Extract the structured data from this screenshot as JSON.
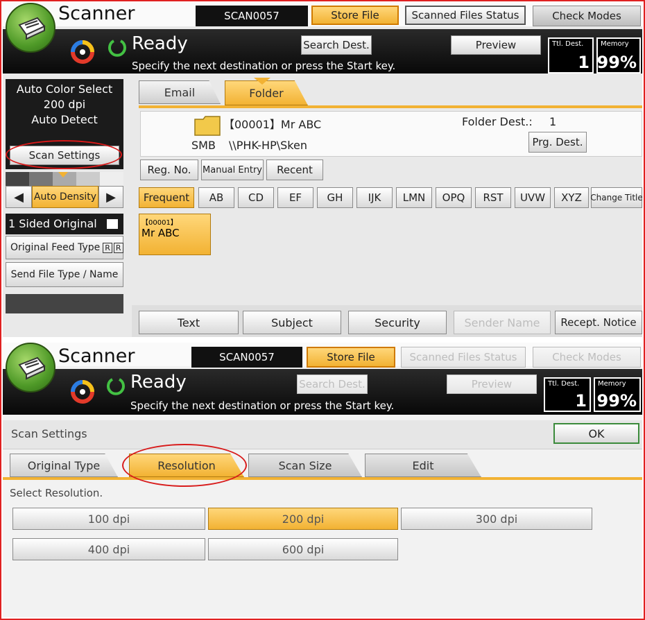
{
  "app": {
    "title": "Scanner",
    "scan_id": "SCAN0057",
    "status": "Ready",
    "instruction": "Specify the next destination or press the Start key.",
    "ttl_dest_label": "Ttl. Dest.",
    "ttl_dest_value": "1",
    "memory_label": "Memory",
    "memory_value": "99%"
  },
  "header_buttons": {
    "store_file": "Store File",
    "scanned_files_status": "Scanned Files Status",
    "check_modes": "Check Modes",
    "search_dest": "Search Dest.",
    "preview": "Preview"
  },
  "panel1": {
    "settings_summary": [
      "Auto Color Select",
      "200 dpi",
      "Auto Detect"
    ],
    "scan_settings_button": "Scan Settings",
    "auto_density": "Auto Density",
    "sided_original": "1 Sided Original",
    "original_feed_type": "Original Feed Type",
    "send_file_type": "Send File Type / Name",
    "tabs": [
      "Email",
      "Folder"
    ],
    "dest": {
      "number": "【00001】Mr ABC",
      "protocol": "SMB",
      "path": "\\\\PHK-HP\\Sken",
      "folder_dest_label": "Folder Dest.:",
      "folder_dest_value": "1",
      "prg_dest": "Prg. Dest."
    },
    "list_buttons": [
      "Reg. No.",
      "Manual Entry",
      "Recent"
    ],
    "index_tabs": [
      "Frequent",
      "AB",
      "CD",
      "EF",
      "GH",
      "IJK",
      "LMN",
      "OPQ",
      "RST",
      "UVW",
      "XYZ",
      "Change Title"
    ],
    "dest_key": {
      "num": "【00001】",
      "name": "Mr ABC"
    },
    "bottom_buttons": [
      "Text",
      "Subject",
      "Security",
      "Sender Name",
      "Recept. Notice"
    ]
  },
  "panel2": {
    "section_title": "Scan Settings",
    "ok": "OK",
    "tabs": [
      "Original Type",
      "Resolution",
      "Scan Size",
      "Edit"
    ],
    "prompt": "Select Resolution.",
    "resolutions": [
      "100 dpi",
      "200 dpi",
      "300 dpi",
      "400 dpi",
      "600 dpi"
    ],
    "selected_resolution": "200 dpi"
  },
  "colors": {
    "accent_yellow": "#f2b233",
    "highlight_red": "#d81b1b",
    "bar_black": "#111111"
  }
}
